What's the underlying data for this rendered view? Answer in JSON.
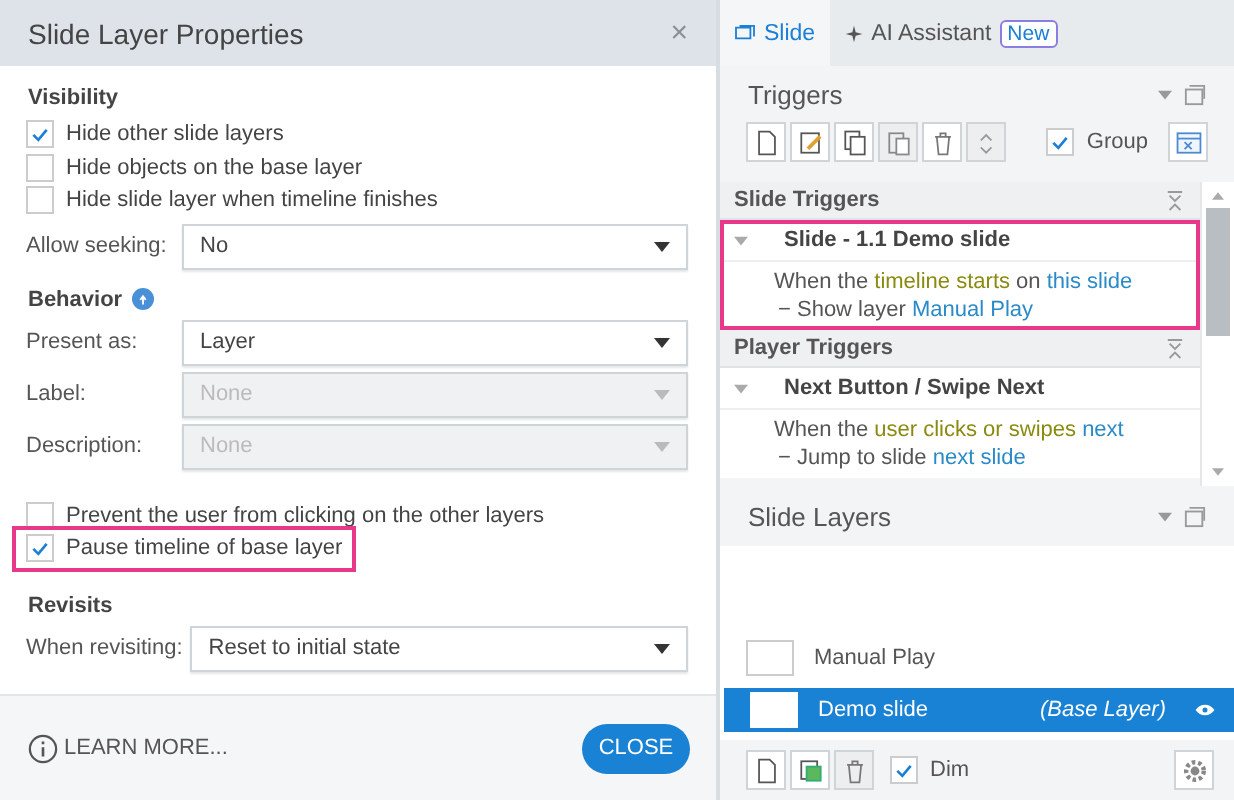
{
  "dialog": {
    "title": "Slide Layer Properties",
    "close": "×",
    "visibility": {
      "heading": "Visibility",
      "checkboxes": [
        {
          "label": "Hide other slide layers",
          "checked": true,
          "highlighted": false
        },
        {
          "label": "Hide objects on the base layer",
          "checked": false,
          "highlighted": false
        },
        {
          "label": "Hide slide layer when timeline finishes",
          "checked": false,
          "highlighted": false
        }
      ],
      "fields": [
        {
          "label": "Allow seeking:",
          "value": "No",
          "disabled": false
        }
      ]
    },
    "behavior": {
      "heading": "Behavior",
      "fields": [
        {
          "label": "Present as:",
          "value": "Layer",
          "disabled": false
        },
        {
          "label": "Label:",
          "value": "None",
          "disabled": true
        },
        {
          "label": "Description:",
          "value": "None",
          "disabled": true
        }
      ],
      "checkboxes": [
        {
          "label": "Prevent the user from clicking on the other layers",
          "checked": false,
          "highlighted": false
        },
        {
          "label": "Pause timeline of base layer",
          "checked": true,
          "highlighted": true
        }
      ]
    },
    "revisits": {
      "heading": "Revisits",
      "fields": [
        {
          "label": "When revisiting:",
          "value": "Reset to initial state",
          "disabled": false
        }
      ]
    },
    "learn_more": "LEARN MORE...",
    "close_button": "CLOSE"
  },
  "panel": {
    "tabs": [
      {
        "label": "Slide",
        "selected": true
      },
      {
        "label": "AI Assistant",
        "selected": false,
        "badge": "New"
      }
    ],
    "triggers": {
      "title": "Triggers",
      "group": {
        "label": "Group",
        "checked": true
      },
      "sections": [
        {
          "title": "Slide Triggers",
          "items": [
            {
              "title": "Slide - 1.1 Demo slide",
              "highlighted": true,
              "lines": [
                [
                  {
                    "text": "When the ",
                    "kind": "plain"
                  },
                  {
                    "text": "timeline starts",
                    "kind": "event"
                  },
                  {
                    "text": " on ",
                    "kind": "plain"
                  },
                  {
                    "text": "this slide",
                    "kind": "object"
                  }
                ],
                [
                  {
                    "text": "− ",
                    "kind": "plain"
                  },
                  {
                    "text": "Show layer ",
                    "kind": "plain"
                  },
                  {
                    "text": "Manual Play",
                    "kind": "object"
                  }
                ]
              ]
            }
          ]
        },
        {
          "title": "Player Triggers",
          "items": [
            {
              "title": "Next Button / Swipe Next",
              "highlighted": false,
              "lines": [
                [
                  {
                    "text": "When the ",
                    "kind": "plain"
                  },
                  {
                    "text": "user clicks or swipes ",
                    "kind": "event"
                  },
                  {
                    "text": "next",
                    "kind": "object"
                  }
                ],
                [
                  {
                    "text": "− ",
                    "kind": "plain"
                  },
                  {
                    "text": "Jump to slide ",
                    "kind": "plain"
                  },
                  {
                    "text": "next slide",
                    "kind": "object"
                  }
                ]
              ]
            }
          ]
        }
      ]
    },
    "layers": {
      "title": "Slide Layers",
      "items": [
        {
          "name": "Manual Play",
          "selected": false
        },
        {
          "name": "Demo slide",
          "selected": true,
          "note": "(Base Layer)"
        }
      ],
      "dim": {
        "label": "Dim",
        "checked": true
      }
    }
  }
}
